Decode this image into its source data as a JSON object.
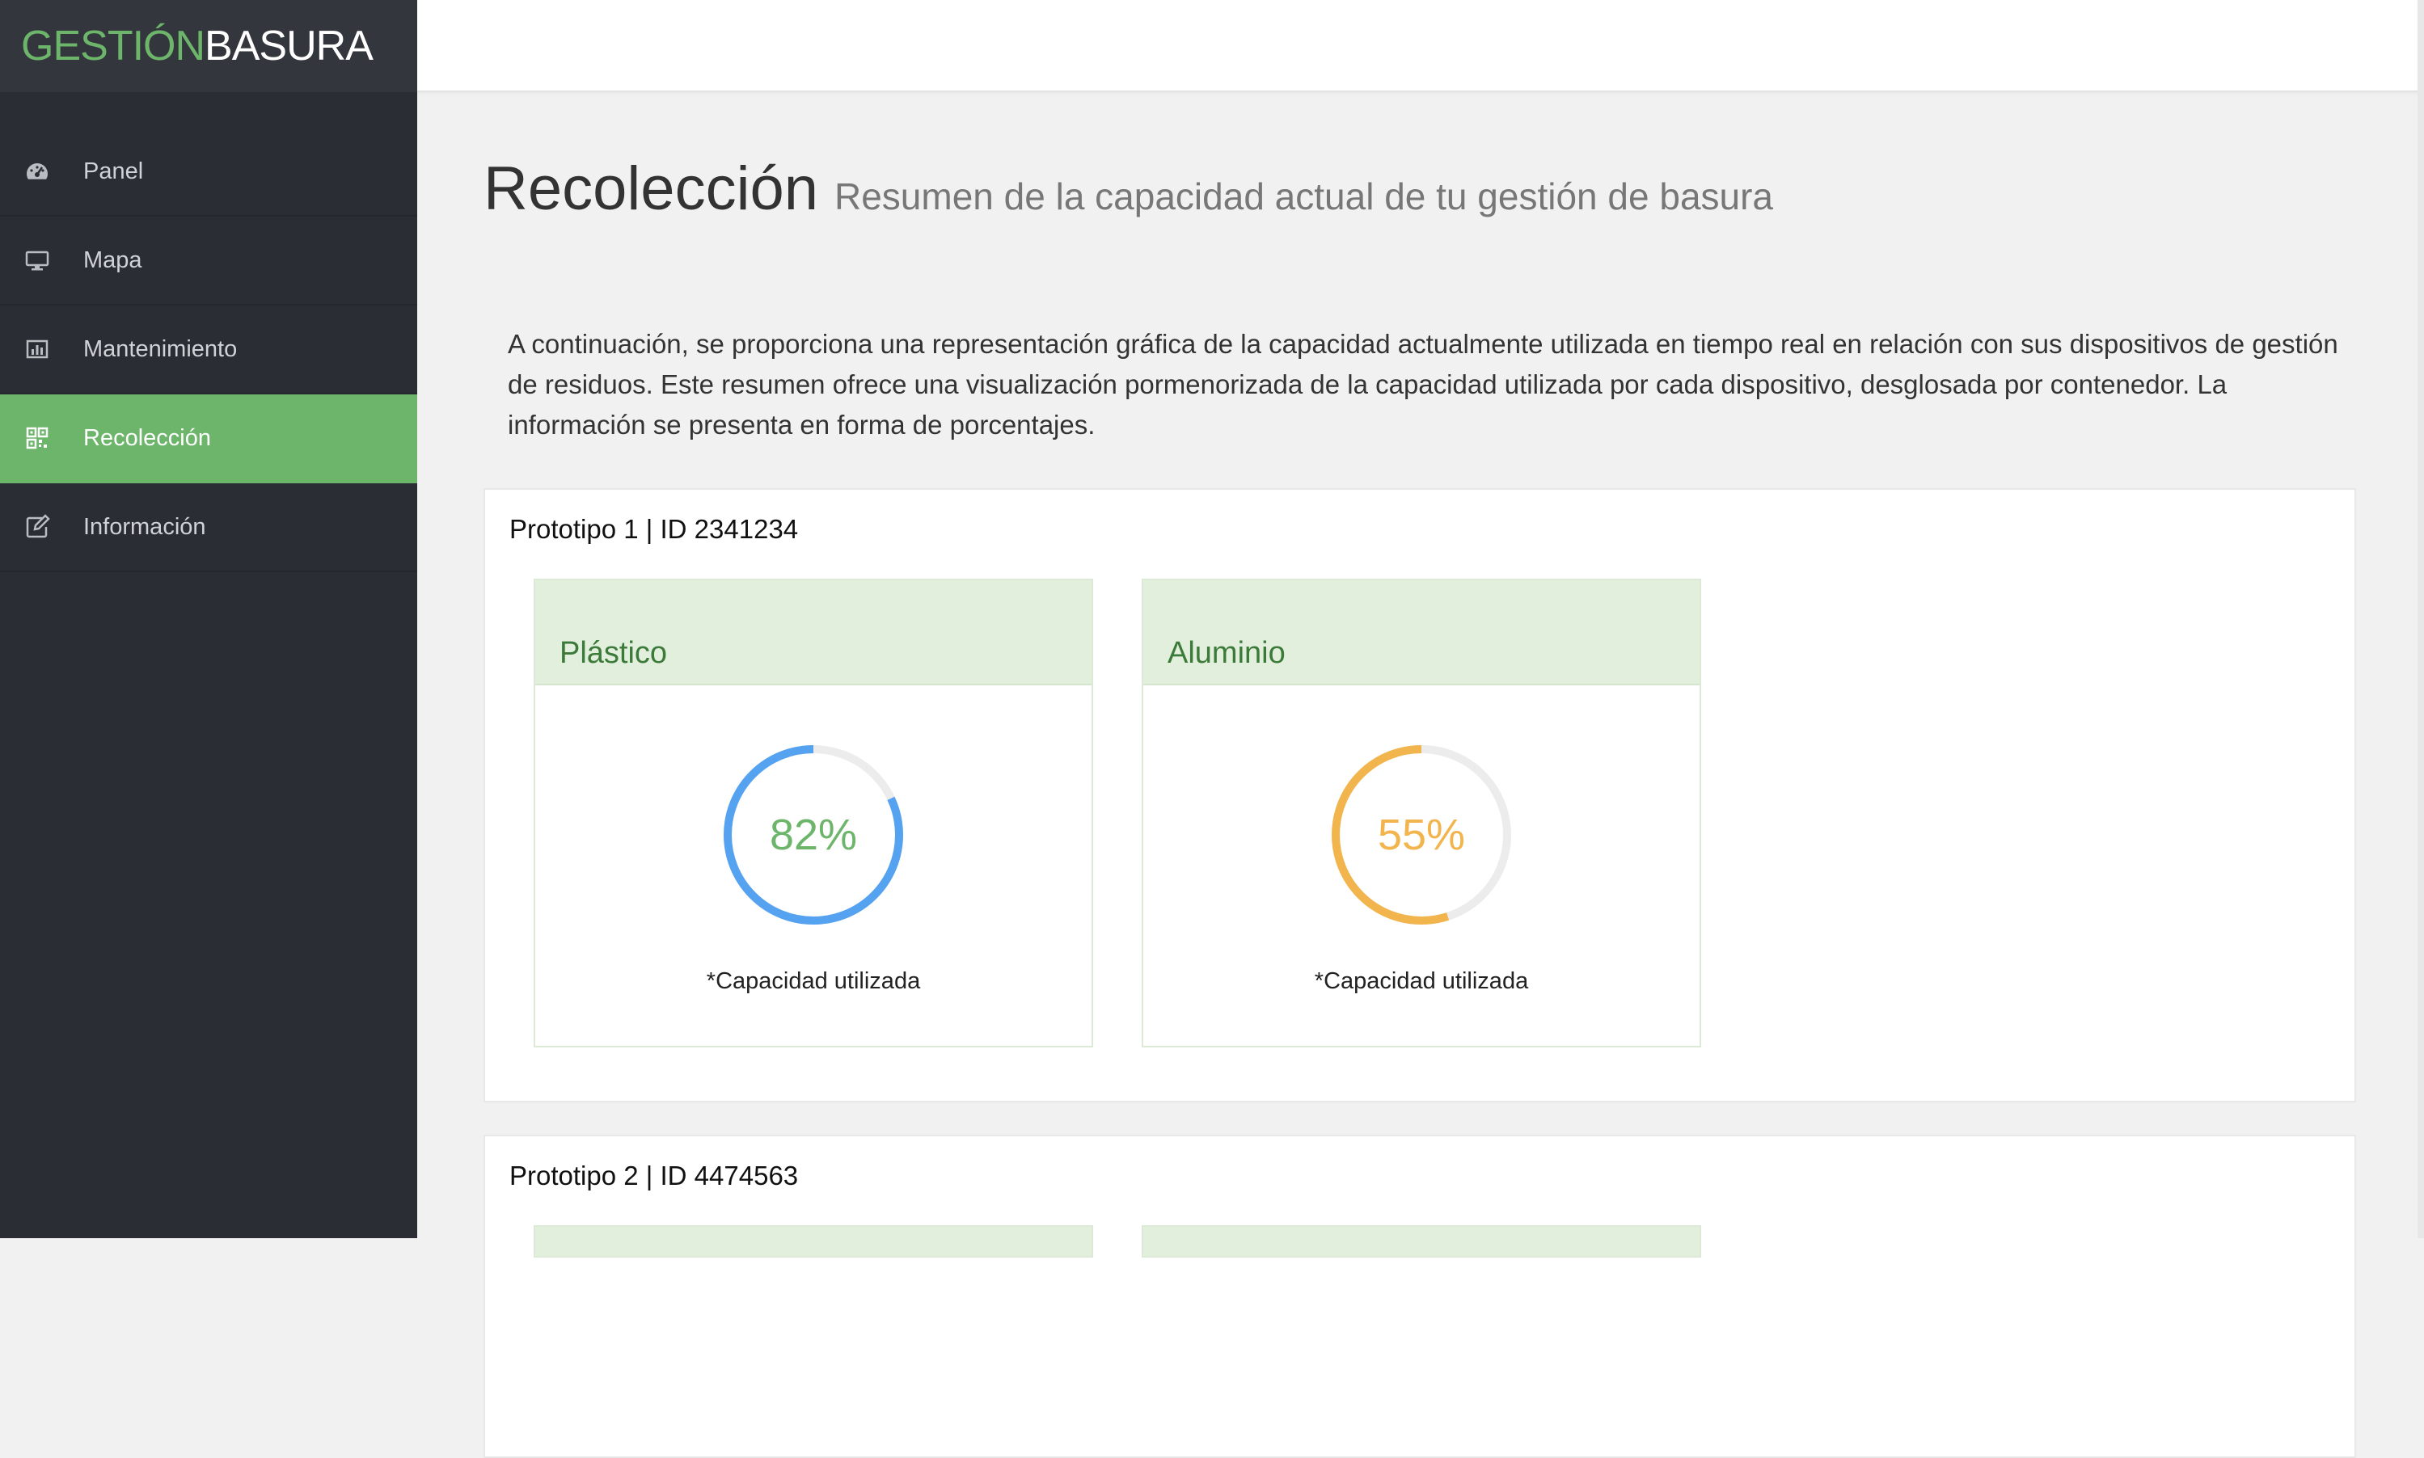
{
  "brand": {
    "part1": "GESTIÓN",
    "part2": "BASURA"
  },
  "sidebar": {
    "items": [
      {
        "label": "Panel",
        "icon": "dashboard-icon"
      },
      {
        "label": "Mapa",
        "icon": "monitor-icon"
      },
      {
        "label": "Mantenimiento",
        "icon": "bar-chart-icon"
      },
      {
        "label": "Recolección",
        "icon": "qrcode-icon",
        "active": true
      },
      {
        "label": "Información",
        "icon": "edit-icon"
      }
    ]
  },
  "page": {
    "title": "Recolección",
    "subtitle": "Resumen de la capacidad actual de tu gestión de basura",
    "intro": "A continuación, se proporciona una representación gráfica de la capacidad actualmente utilizada en tiempo real en relación con sus dispositivos de gestión de residuos. Este resumen ofrece una visualización pormenorizada de la capacidad utilizada por cada dispositivo, desglosada por contenedor. La información se presenta en forma de porcentajes."
  },
  "devices": [
    {
      "title": "Prototipo 1 | ID 2341234",
      "containers": [
        {
          "name": "Plástico",
          "percent_label": "82%",
          "fill_fraction": 0.82,
          "ring_color": "#55a3f0",
          "text_color": "#6db56b",
          "caption": "*Capacidad utilizada"
        },
        {
          "name": "Aluminio",
          "percent_label": "55%",
          "fill_fraction": 0.55,
          "ring_color": "#f2b54e",
          "text_color": "#f2b54e",
          "caption": "*Capacidad utilizada"
        }
      ]
    },
    {
      "title": "Prototipo 2 | ID 4474563"
    }
  ],
  "colors": {
    "accent": "#6db56b",
    "sidebar_bg": "#2a2d33",
    "track": "#ececec"
  }
}
